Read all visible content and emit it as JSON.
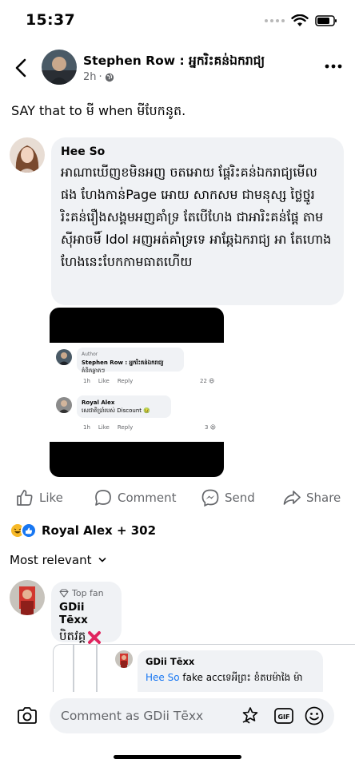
{
  "status_bar": {
    "time": "15:37",
    "icons": [
      "signal-icon",
      "wifi-icon",
      "battery-icon"
    ]
  },
  "post": {
    "author": "Stephen Row : អ្នករិះគន់ឯករាជ្យ",
    "time": "2h",
    "privacy_icon": "globe-icon",
    "text": "SAY that to មី when មីបែកនូត."
  },
  "top_comment": {
    "author": "Hee So",
    "text": "អាណាឃើញខមិនអញ ចតអោយ ផ្ដែរិះគន់ឯករាជ្យមើល ផង ហែងកាន់Page អោយ សាកសម ជាមនុស្ស ថ្លៃថ្នូរ រិះគន់រឿងសង្គមអញគាំទ្រ តែបើហែង ជាអារិះគន់ផ្ដែ តាមស៊ីអាចមិ៍ Idol អញអត់គាំទ្រទេ អាឆ្កែឯករាជ្យ អា តែហោង ហែងនេះបែកកាមធាតហើយ",
    "screenshot": {
      "comment1": {
        "tag": "Author",
        "name": "Stephen Row : អ្នករិះគន់ឯករាជ្យ",
        "text": "គំនិតឆ្លាតៗ",
        "time": "1h",
        "like": "Like",
        "reply": "Reply",
        "count": "22"
      },
      "comment2": {
        "name": "Royal Alex",
        "text": "សេជាតិប្រាំរបស់ Discount",
        "time": "1h",
        "like": "Like",
        "reply": "Reply",
        "count": "3"
      }
    }
  },
  "actions": {
    "like": "Like",
    "comment": "Comment",
    "send": "Send",
    "share": "Share"
  },
  "reactions": {
    "summary": "Royal Alex + 302"
  },
  "sort": {
    "label": "Most relevant"
  },
  "reply": {
    "badge": "Top fan",
    "author": "GDii Tēxx",
    "text": "បិតវគ្គ"
  },
  "nested_reply": {
    "author": "GDii Tēxx",
    "mention": "Hee So",
    "text": "fake accទេអីព្រះ ខំតបម៉ាងៃ ម៉ា"
  },
  "composer": {
    "placeholder": "Comment as GDii Tēxx"
  },
  "colors": {
    "accent": "#1877f2",
    "bubble": "#f0f2f5",
    "muted": "#65676b",
    "haha": "#f7b928",
    "like_blue": "#1877f2",
    "x_red": "#e0245e"
  }
}
